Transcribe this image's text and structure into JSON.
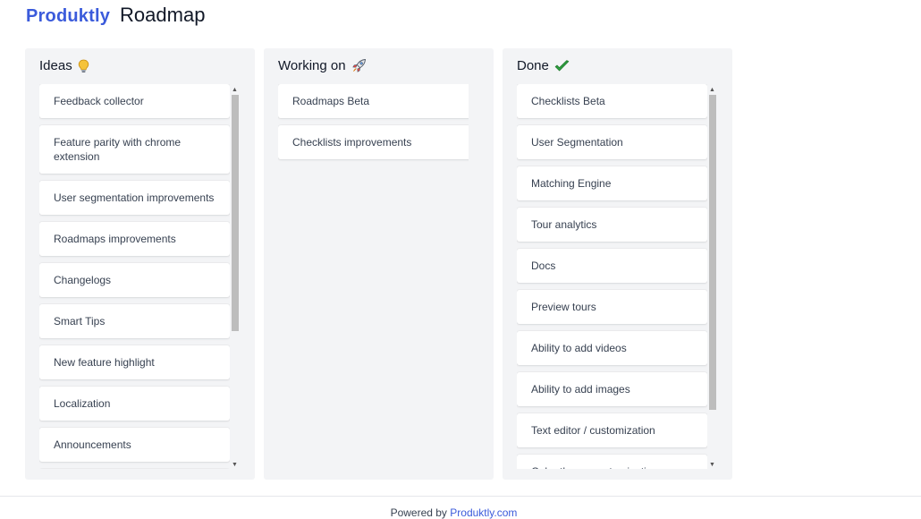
{
  "header": {
    "logo": "Produktly",
    "title": "Roadmap"
  },
  "columns": [
    {
      "title": "Ideas",
      "icon": "lightbulb-icon",
      "items": [
        "Feedback collector",
        "Feature parity with chrome extension",
        "User segmentation improvements",
        "Roadmaps improvements",
        "Changelogs",
        "Smart Tips",
        "New feature highlight",
        "Localization",
        "Announcements",
        ""
      ]
    },
    {
      "title": "Working on",
      "icon": "rocket-icon",
      "items": [
        "Roadmaps Beta",
        "Checklists improvements"
      ]
    },
    {
      "title": "Done",
      "icon": "checkmark-icon",
      "items": [
        "Checklists Beta",
        "User Segmentation",
        "Matching Engine",
        "Tour analytics",
        "Docs",
        "Preview tours",
        "Ability to add videos",
        "Ability to add images",
        "Text editor / customization",
        "Color theme customization"
      ]
    }
  ],
  "footer": {
    "text": "Powered by",
    "link": "Produktly.com"
  },
  "colors": {
    "brand": "#3b5bdb",
    "column_bg": "#f3f4f6",
    "check": "#2e9e3f"
  }
}
